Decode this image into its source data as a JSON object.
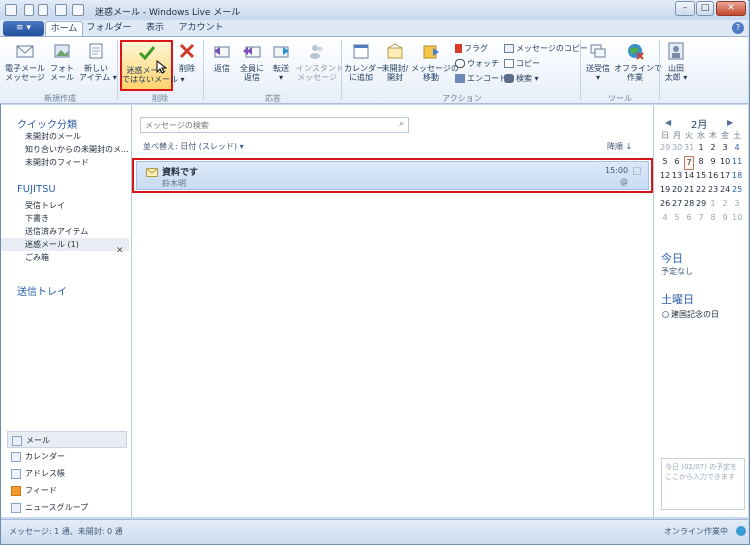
{
  "window": {
    "title": "迷惑メール - Windows Live メール",
    "minimize": "–",
    "restore": "□",
    "close": "✕"
  },
  "tabs": [
    {
      "label": "ホーム",
      "selected": true
    },
    {
      "label": "フォルダー",
      "selected": false
    },
    {
      "label": "表示",
      "selected": false
    },
    {
      "label": "アカウント",
      "selected": false
    }
  ],
  "file_button": "≡ ▾",
  "help": "?",
  "ribbon": {
    "new": {
      "group": "新規作成",
      "email": [
        "電子メール",
        "メッセージ"
      ],
      "photo": [
        "フォト",
        "メール"
      ],
      "new_item": [
        "新しい",
        "アイテム ▾"
      ]
    },
    "delete": {
      "group": "削除",
      "not_junk": [
        "迷惑メール",
        "ではないメール ▾"
      ],
      "delete": "削除"
    },
    "respond": {
      "group": "応答",
      "reply": "返信",
      "reply_all": [
        "全員に",
        "返信"
      ],
      "forward": [
        "転送",
        "▾"
      ],
      "instant": [
        "インスタント",
        "メッセージ"
      ]
    },
    "actions": {
      "group": "アクション",
      "add_calendar": [
        "カレンダー",
        "に追加"
      ],
      "unread": [
        "未開封/",
        "開封"
      ],
      "move": [
        "メッセージの",
        "移動"
      ],
      "flag": "フラグ",
      "watch": "ウォッチ",
      "encode": "エンコード",
      "copy_to": "メッセージのコピー",
      "copy": "コピー",
      "find": "検索 ▾"
    },
    "tools": {
      "group": "ツール",
      "send_receive": [
        "送受信",
        "▾"
      ],
      "offline": [
        "オフラインで",
        "作業"
      ]
    },
    "user": {
      "name": [
        "山田",
        "太郎 ▾"
      ]
    }
  },
  "left": {
    "quick_heading": "クイック分類",
    "quick": [
      "未開封のメール",
      "知り合いからの未開封のメ...",
      "未開封のフィード"
    ],
    "account": "FUJITSU",
    "folders": [
      {
        "label": "受信トレイ",
        "selected": false
      },
      {
        "label": "下書き",
        "selected": false
      },
      {
        "label": "送信済みアイテム",
        "selected": false
      },
      {
        "label": "迷惑メール (1)",
        "selected": true
      },
      {
        "label": "ごみ箱",
        "selected": false
      }
    ],
    "outbox": "送信トレイ",
    "junk_close": "✕",
    "nav": [
      {
        "label": "メール",
        "selected": true
      },
      {
        "label": "カレンダー",
        "selected": false
      },
      {
        "label": "アドレス帳",
        "selected": false
      },
      {
        "label": "フィード",
        "selected": false
      },
      {
        "label": "ニュースグループ",
        "selected": false
      }
    ]
  },
  "center": {
    "search_placeholder": "メッセージの検索",
    "sort": "並べ替え: 日付 (スレッド) ▾",
    "order": "降順 ↓",
    "message": {
      "subject": "資料です",
      "sender": "鈴木明",
      "time": "15:00",
      "attach": "@"
    }
  },
  "calendar": {
    "prev": "◀",
    "month": "2月",
    "next": "▶",
    "weekdays": [
      "日",
      "月",
      "火",
      "水",
      "木",
      "金",
      "土"
    ],
    "weeks": [
      [
        "29",
        "30",
        "31",
        "1",
        "2",
        "3",
        "4"
      ],
      [
        "5",
        "6",
        "7",
        "8",
        "9",
        "10",
        "11"
      ],
      [
        "12",
        "13",
        "14",
        "15",
        "16",
        "17",
        "18"
      ],
      [
        "19",
        "20",
        "21",
        "22",
        "23",
        "24",
        "25"
      ],
      [
        "26",
        "27",
        "28",
        "29",
        "1",
        "2",
        "3"
      ],
      [
        "4",
        "5",
        "6",
        "7",
        "8",
        "9",
        "10"
      ]
    ],
    "today_heading": "今日",
    "today_text": "予定なし",
    "sat_heading": "土曜日",
    "sat_event": "建国記念の日",
    "quick_add": "今日 (02/07) の予定をここから入力できます"
  },
  "status": {
    "left": "メッセージ: 1 通、未開封: 0 通",
    "right": "オンライン作業中"
  }
}
